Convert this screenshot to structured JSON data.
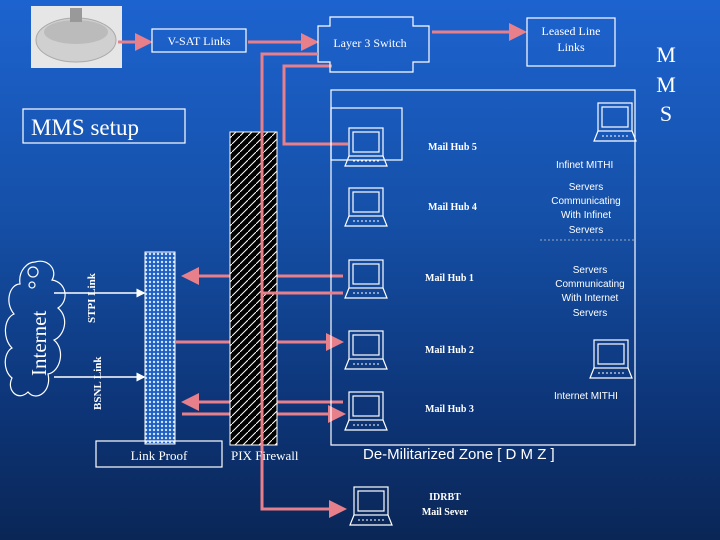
{
  "title": "MMS setup",
  "side_label": [
    "M",
    "M",
    "S"
  ],
  "nodes": {
    "vsat": "V-SAT Links",
    "switch": "Layer 3 Switch",
    "leased": [
      "Leased Line",
      "Links"
    ],
    "internet": "Internet",
    "stpi": "STPI Link",
    "bsnl": "BSNL Link",
    "link_proof": "Link Proof",
    "firewall": "PIX Firewall",
    "dmz": "De-Militarized Zone [ D M Z ]",
    "hub5": "Mail Hub 5",
    "hub4": "Mail Hub 4",
    "hub1": "Mail Hub 1",
    "hub2": "Mail Hub 2",
    "hub3": "Mail Hub 3",
    "infinet": "Infinet MITHI",
    "infinet_servers": [
      "Servers",
      "Communicating",
      "With Infinet",
      "Servers"
    ],
    "internet_servers": [
      "Servers",
      "Communicating",
      "With Internet",
      "Servers"
    ],
    "internet_mithi": "Internet MITHI",
    "idrbt": [
      "IDRBT",
      "Mail Sever"
    ]
  },
  "colors": {
    "link": "#e8808c",
    "background": "#1a5cc4",
    "lines": "#ffffff"
  }
}
